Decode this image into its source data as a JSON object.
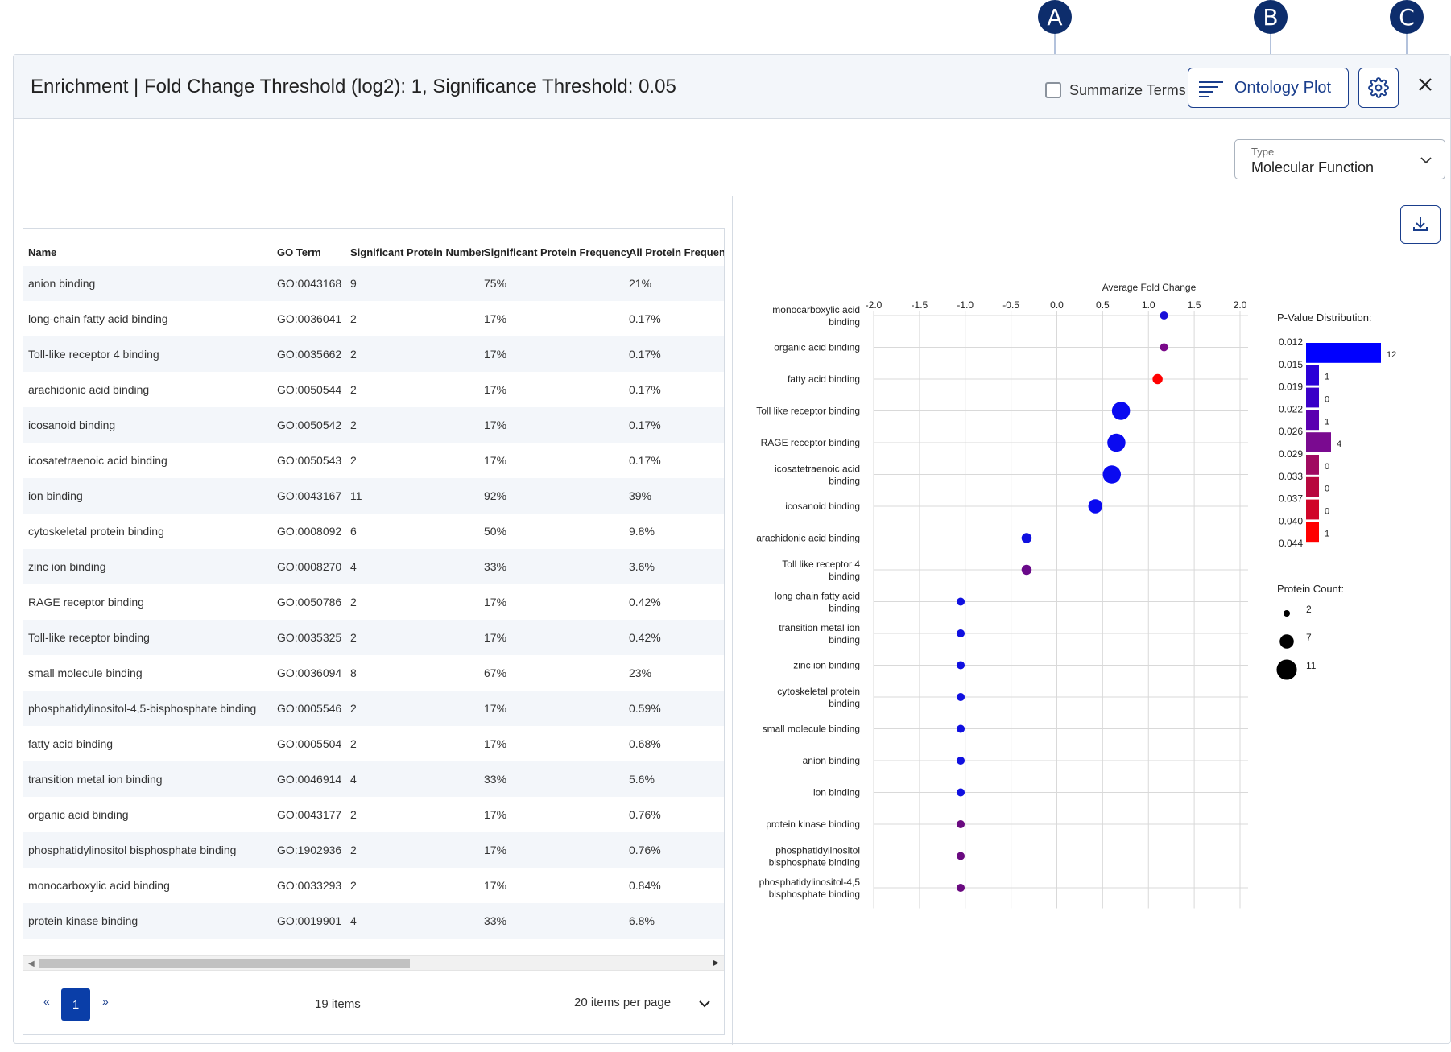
{
  "callouts": [
    "A",
    "B",
    "C"
  ],
  "header": {
    "title": "Enrichment | Fold Change Threshold (log2): 1, Significance Threshold: 0.05",
    "summarize_label": "Summarize Terms",
    "summarize_checked": false,
    "ontology_button": "Ontology Plot"
  },
  "type_select": {
    "label": "Type",
    "value": "Molecular Function"
  },
  "table": {
    "columns": [
      "Name",
      "GO Term",
      "Significant Protein Number",
      "Significant Protein Frequency",
      "All Protein Frequenc"
    ],
    "rows": [
      [
        "anion binding",
        "GO:0043168",
        "9",
        "75%",
        "21%"
      ],
      [
        "long-chain fatty acid binding",
        "GO:0036041",
        "2",
        "17%",
        "0.17%"
      ],
      [
        "Toll-like receptor 4 binding",
        "GO:0035662",
        "2",
        "17%",
        "0.17%"
      ],
      [
        "arachidonic acid binding",
        "GO:0050544",
        "2",
        "17%",
        "0.17%"
      ],
      [
        "icosanoid binding",
        "GO:0050542",
        "2",
        "17%",
        "0.17%"
      ],
      [
        "icosatetraenoic acid binding",
        "GO:0050543",
        "2",
        "17%",
        "0.17%"
      ],
      [
        "ion binding",
        "GO:0043167",
        "11",
        "92%",
        "39%"
      ],
      [
        "cytoskeletal protein binding",
        "GO:0008092",
        "6",
        "50%",
        "9.8%"
      ],
      [
        "zinc ion binding",
        "GO:0008270",
        "4",
        "33%",
        "3.6%"
      ],
      [
        "RAGE receptor binding",
        "GO:0050786",
        "2",
        "17%",
        "0.42%"
      ],
      [
        "Toll-like receptor binding",
        "GO:0035325",
        "2",
        "17%",
        "0.42%"
      ],
      [
        "small molecule binding",
        "GO:0036094",
        "8",
        "67%",
        "23%"
      ],
      [
        "phosphatidylinositol-4,5-bisphosphate binding",
        "GO:0005546",
        "2",
        "17%",
        "0.59%"
      ],
      [
        "fatty acid binding",
        "GO:0005504",
        "2",
        "17%",
        "0.68%"
      ],
      [
        "transition metal ion binding",
        "GO:0046914",
        "4",
        "33%",
        "5.6%"
      ],
      [
        "organic acid binding",
        "GO:0043177",
        "2",
        "17%",
        "0.76%"
      ],
      [
        "phosphatidylinositol bisphosphate binding",
        "GO:1902936",
        "2",
        "17%",
        "0.76%"
      ],
      [
        "monocarboxylic acid binding",
        "GO:0033293",
        "2",
        "17%",
        "0.84%"
      ],
      [
        "protein kinase binding",
        "GO:0019901",
        "4",
        "33%",
        "6.8%"
      ]
    ]
  },
  "pager": {
    "prev": "«",
    "page": "1",
    "next": "»",
    "items": "19 items",
    "per_page": "20 items per page"
  },
  "chart_data": {
    "type": "scatter",
    "xlabel": "Average Fold Change",
    "xlim": [
      -2.0,
      2.0
    ],
    "x_ticks": [
      "-2.0",
      "-1.5",
      "-1.0",
      "-0.5",
      "0.0",
      "0.5",
      "1.0",
      "1.5",
      "2.0"
    ],
    "points": [
      {
        "label": [
          "monocarboxylic acid",
          "binding"
        ],
        "x": 1.17,
        "count": 2,
        "color": "#1a10d8"
      },
      {
        "label": [
          "organic acid binding"
        ],
        "x": 1.17,
        "count": 2,
        "color": "#7a0a8a"
      },
      {
        "label": [
          "fatty acid binding"
        ],
        "x": 1.1,
        "count": 3,
        "color": "#ff0000"
      },
      {
        "label": [
          "Toll like receptor binding"
        ],
        "x": 0.7,
        "count": 7,
        "color": "#0a0af0"
      },
      {
        "label": [
          "RAGE receptor binding"
        ],
        "x": 0.65,
        "count": 7,
        "color": "#0a0af0"
      },
      {
        "label": [
          "icosatetraenoic acid",
          "binding"
        ],
        "x": 0.6,
        "count": 7,
        "color": "#0a0af0"
      },
      {
        "label": [
          "icosanoid binding"
        ],
        "x": 0.42,
        "count": 5,
        "color": "#0a0af0"
      },
      {
        "label": [
          "arachidonic acid binding"
        ],
        "x": -0.33,
        "count": 3,
        "color": "#1010e0"
      },
      {
        "label": [
          "Toll like receptor 4",
          "binding"
        ],
        "x": -0.33,
        "count": 3,
        "color": "#6a0a8a"
      },
      {
        "label": [
          "long chain fatty acid",
          "binding"
        ],
        "x": -1.05,
        "count": 2,
        "color": "#1010e0"
      },
      {
        "label": [
          "transition metal ion",
          "binding"
        ],
        "x": -1.05,
        "count": 2,
        "color": "#1010e0"
      },
      {
        "label": [
          "zinc ion binding"
        ],
        "x": -1.05,
        "count": 2,
        "color": "#1010e0"
      },
      {
        "label": [
          "cytoskeletal protein",
          "binding"
        ],
        "x": -1.05,
        "count": 2,
        "color": "#1010e0"
      },
      {
        "label": [
          "small molecule binding"
        ],
        "x": -1.05,
        "count": 2,
        "color": "#1010e0"
      },
      {
        "label": [
          "anion binding"
        ],
        "x": -1.05,
        "count": 2,
        "color": "#1010e0"
      },
      {
        "label": [
          "ion binding"
        ],
        "x": -1.05,
        "count": 2,
        "color": "#1010e0"
      },
      {
        "label": [
          "protein kinase binding"
        ],
        "x": -1.05,
        "count": 2,
        "color": "#6a0a80"
      },
      {
        "label": [
          "phosphatidylinositol",
          "bisphosphate binding"
        ],
        "x": -1.05,
        "count": 2,
        "color": "#6a0a80"
      },
      {
        "label": [
          "phosphatidylinositol-4,5",
          "bisphosphate binding"
        ],
        "x": -1.05,
        "count": 2,
        "color": "#6a0a80"
      }
    ],
    "pvalue_distribution": {
      "title": "P-Value Distribution:",
      "edges": [
        "0.012",
        "0.015",
        "0.019",
        "0.022",
        "0.026",
        "0.029",
        "0.033",
        "0.037",
        "0.040",
        "0.044"
      ],
      "counts": [
        12,
        1,
        0,
        1,
        4,
        0,
        0,
        0,
        1
      ],
      "colors": [
        "#0000ff",
        "#2a00d8",
        "#3a00c8",
        "#5a00b0",
        "#7a0a90",
        "#a00a60",
        "#b8083e",
        "#d00428",
        "#ff0000"
      ]
    },
    "protein_count_legend": {
      "title": "Protein Count:",
      "entries": [
        {
          "label": "2",
          "count": 2
        },
        {
          "label": "7",
          "count": 7
        },
        {
          "label": "11",
          "count": 11
        }
      ]
    }
  }
}
